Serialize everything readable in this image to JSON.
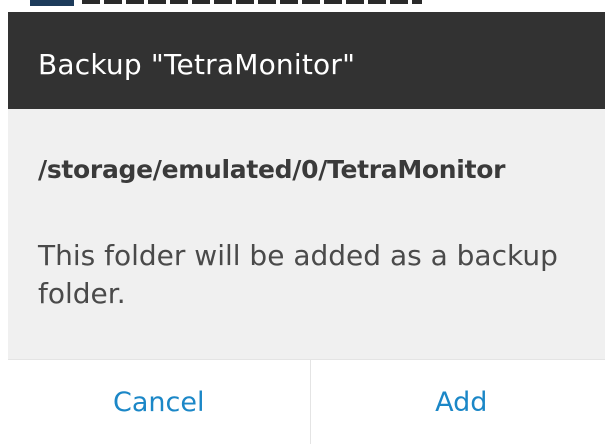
{
  "dialog": {
    "title": "Backup \"TetraMonitor\"",
    "folder_path": "/storage/emulated/0/TetraMonitor",
    "message": "This folder will be added as a backup folder.",
    "buttons": {
      "cancel_label": "Cancel",
      "add_label": "Add"
    }
  },
  "colors": {
    "title_bar": "#323232",
    "dialog_background": "#f0f0f0",
    "button_text": "#1b87c7"
  }
}
